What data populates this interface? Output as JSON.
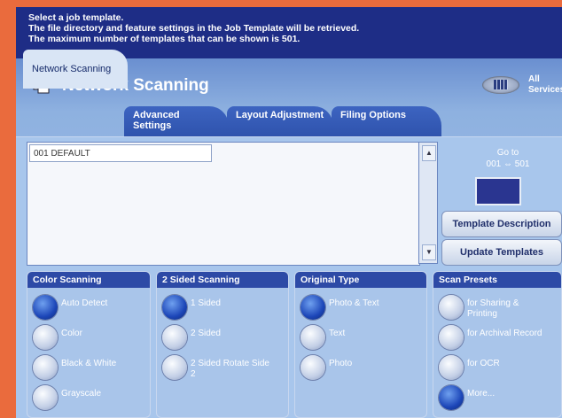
{
  "message": {
    "line1": "Select a job template.",
    "line2": "The file directory and feature settings in the Job Template will be retrieved.",
    "line3": "The maximum number of templates that can be shown is 501."
  },
  "header": {
    "title": "Network Scanning",
    "all_services": "All Services"
  },
  "tabs": [
    {
      "label": "Network Scanning"
    },
    {
      "label": "Advanced Settings"
    },
    {
      "label": "Layout Adjustment"
    },
    {
      "label": "Filing Options"
    }
  ],
  "template_list": {
    "items": [
      {
        "label": "001  DEFAULT"
      }
    ]
  },
  "goto": {
    "label": "Go to",
    "range": "001 ⇔ 501"
  },
  "buttons": {
    "template_description": "Template Description",
    "update_templates": "Update Templates"
  },
  "groups": {
    "color_scanning": {
      "title": "Color Scanning",
      "options": [
        "Auto Detect",
        "Color",
        "Black & White",
        "Grayscale"
      ],
      "selected": "Auto Detect"
    },
    "two_sided": {
      "title": "2 Sided Scanning",
      "options": [
        "1 Sided",
        "2 Sided",
        "2 Sided Rotate Side 2"
      ],
      "selected": "1 Sided"
    },
    "original_type": {
      "title": "Original Type",
      "options": [
        "Photo & Text",
        "Text",
        "Photo"
      ],
      "selected": "Photo & Text"
    },
    "scan_presets": {
      "title": "Scan Presets",
      "options": [
        "for Sharing & Printing",
        "for Archival Record",
        "for OCR",
        "More..."
      ],
      "selected": "More..."
    }
  },
  "colors": {
    "bezel": "#ea6b3d",
    "screen": "#1e2d86",
    "panel": "#a8c6ec",
    "selected_radio": "#1c46b8"
  }
}
